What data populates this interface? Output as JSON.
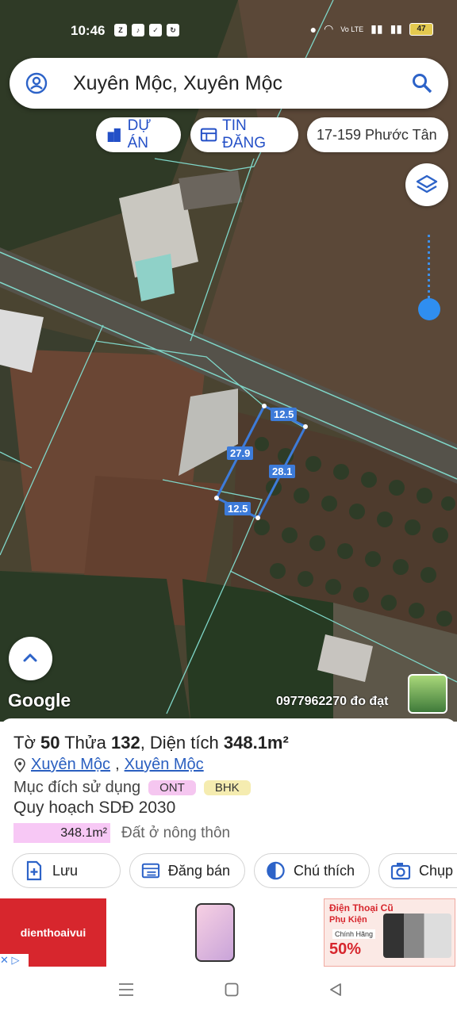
{
  "status_bar": {
    "time": "10:46",
    "battery": "47",
    "network": "Vo LTE",
    "app_icons": [
      "Zalo",
      "TikTok",
      "checkbox",
      "refresh"
    ]
  },
  "search": {
    "query": "Xuyên Mộc, Xuyên Mộc",
    "icon_left": "user-icon",
    "icon_right": "search-icon"
  },
  "chips": {
    "du_an": "DỰ ÁN",
    "tin_dang": "TIN ĐĂNG",
    "place": "17-159 Phước Tân"
  },
  "map": {
    "provider": "Google",
    "phone_label": "0977962270 đo đạt",
    "dimensions": [
      "12.5",
      "27.9",
      "28.1",
      "12.5"
    ],
    "accent": "#3d7bd9"
  },
  "parcel": {
    "sheet_label": "Tờ",
    "sheet_no": "50",
    "plot_label": "Thửa",
    "plot_no": "132",
    "area_label": "Diện tích",
    "area": "348.1m²",
    "address_parts": [
      "Xuyên Mộc",
      "Xuyên Mộc"
    ],
    "usage_label": "Mục đích sử dụng",
    "usage_badges": [
      "ONT",
      "BHK"
    ],
    "plan_title": "Quy hoạch SDĐ 2030",
    "plan_area": "348.1m²",
    "plan_desc": "Đất ở nông thôn"
  },
  "actions": [
    {
      "label": "Lưu",
      "icon": "save-add-icon"
    },
    {
      "label": "Đăng bán",
      "icon": "listing-icon"
    },
    {
      "label": "Chú thích",
      "icon": "legend-icon"
    },
    {
      "label": "Chụp",
      "icon": "camera-icon"
    }
  ],
  "ad": {
    "brand": "dienthoaivui",
    "promo_line1": "Điện Thoại Cũ",
    "promo_line2": "Phụ Kiện",
    "promo_line3": "Chính Hãng",
    "promo_pct": "50%"
  },
  "navbar": [
    "menu-icon",
    "home-icon",
    "back-icon"
  ]
}
